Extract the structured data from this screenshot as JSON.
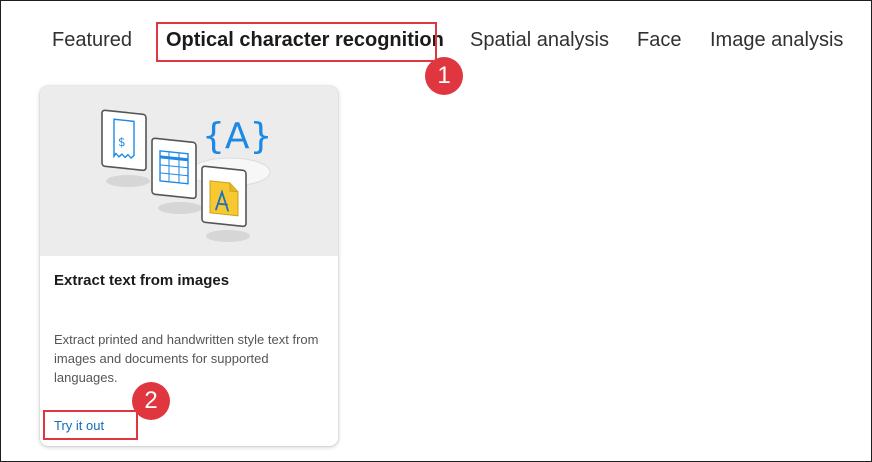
{
  "tabs": [
    {
      "label": "Featured"
    },
    {
      "label": "Optical character recognition",
      "selected": true
    },
    {
      "label": "Spatial analysis"
    },
    {
      "label": "Face"
    },
    {
      "label": "Image analysis"
    }
  ],
  "callouts": [
    "1",
    "2"
  ],
  "card": {
    "hero_glyph_braces": "{A}",
    "title": "Extract text from images",
    "description": "Extract printed and handwritten style text from images and documents for supported languages.",
    "link": "Try it out"
  },
  "colors": {
    "highlight": "#e0363f",
    "link": "#0f6cbd",
    "accent_blue": "#1e88e5"
  }
}
